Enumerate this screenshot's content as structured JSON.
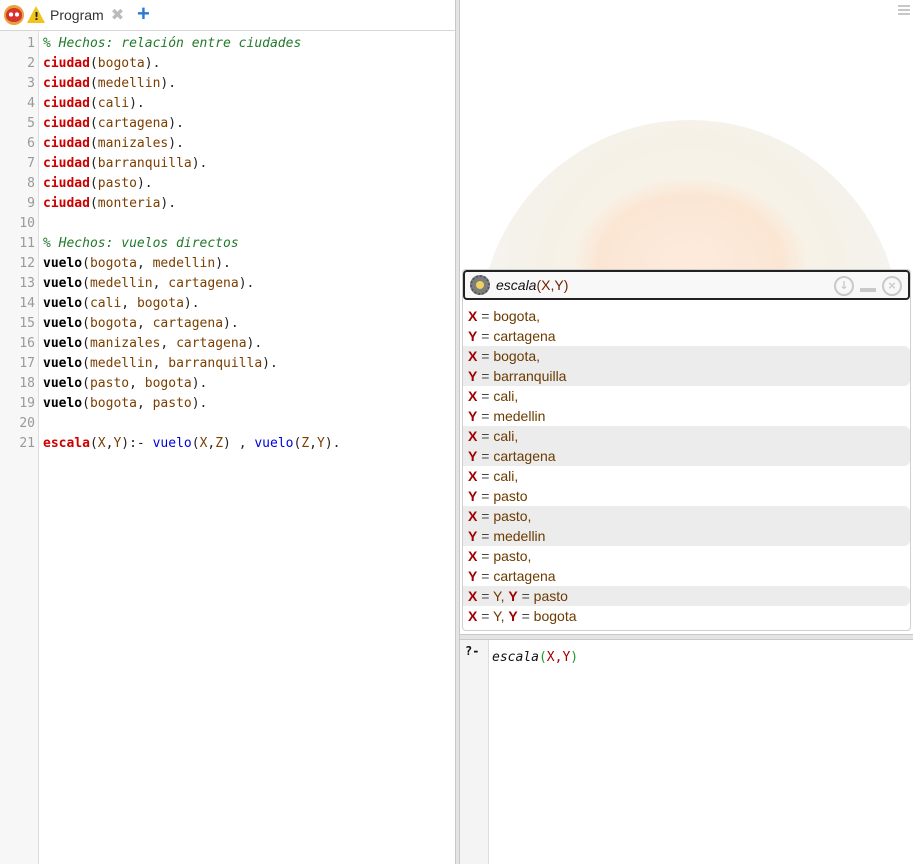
{
  "tabs": [
    {
      "label": "Program",
      "icon": "warning-icon"
    }
  ],
  "code_lines": [
    [
      {
        "c": "cmt",
        "t": "% Hechos: relación entre ciudades"
      }
    ],
    [
      {
        "c": "fact",
        "t": "ciudad"
      },
      {
        "c": "op",
        "t": "("
      },
      {
        "c": "arg",
        "t": "bogota"
      },
      {
        "c": "op",
        "t": ")."
      }
    ],
    [
      {
        "c": "fact",
        "t": "ciudad"
      },
      {
        "c": "op",
        "t": "("
      },
      {
        "c": "arg",
        "t": "medellin"
      },
      {
        "c": "op",
        "t": ")."
      }
    ],
    [
      {
        "c": "fact",
        "t": "ciudad"
      },
      {
        "c": "op",
        "t": "("
      },
      {
        "c": "arg",
        "t": "cali"
      },
      {
        "c": "op",
        "t": ")."
      }
    ],
    [
      {
        "c": "fact",
        "t": "ciudad"
      },
      {
        "c": "op",
        "t": "("
      },
      {
        "c": "arg",
        "t": "cartagena"
      },
      {
        "c": "op",
        "t": ")."
      }
    ],
    [
      {
        "c": "fact",
        "t": "ciudad"
      },
      {
        "c": "op",
        "t": "("
      },
      {
        "c": "arg",
        "t": "manizales"
      },
      {
        "c": "op",
        "t": ")."
      }
    ],
    [
      {
        "c": "fact",
        "t": "ciudad"
      },
      {
        "c": "op",
        "t": "("
      },
      {
        "c": "arg",
        "t": "barranquilla"
      },
      {
        "c": "op",
        "t": ")."
      }
    ],
    [
      {
        "c": "fact",
        "t": "ciudad"
      },
      {
        "c": "op",
        "t": "("
      },
      {
        "c": "arg",
        "t": "pasto"
      },
      {
        "c": "op",
        "t": ")."
      }
    ],
    [
      {
        "c": "fact",
        "t": "ciudad"
      },
      {
        "c": "op",
        "t": "("
      },
      {
        "c": "arg",
        "t": "monteria"
      },
      {
        "c": "op",
        "t": ")."
      }
    ],
    [],
    [
      {
        "c": "cmt",
        "t": "% Hechos: vuelos directos"
      }
    ],
    [
      {
        "c": "pred",
        "t": "vuelo"
      },
      {
        "c": "op",
        "t": "("
      },
      {
        "c": "arg",
        "t": "bogota"
      },
      {
        "c": "op",
        "t": ", "
      },
      {
        "c": "arg",
        "t": "medellin"
      },
      {
        "c": "op",
        "t": ")."
      }
    ],
    [
      {
        "c": "pred",
        "t": "vuelo"
      },
      {
        "c": "op",
        "t": "("
      },
      {
        "c": "arg",
        "t": "medellin"
      },
      {
        "c": "op",
        "t": ", "
      },
      {
        "c": "arg",
        "t": "cartagena"
      },
      {
        "c": "op",
        "t": ")."
      }
    ],
    [
      {
        "c": "pred",
        "t": "vuelo"
      },
      {
        "c": "op",
        "t": "("
      },
      {
        "c": "arg",
        "t": "cali"
      },
      {
        "c": "op",
        "t": ", "
      },
      {
        "c": "arg",
        "t": "bogota"
      },
      {
        "c": "op",
        "t": ")."
      }
    ],
    [
      {
        "c": "pred",
        "t": "vuelo"
      },
      {
        "c": "op",
        "t": "("
      },
      {
        "c": "arg",
        "t": "bogota"
      },
      {
        "c": "op",
        "t": ", "
      },
      {
        "c": "arg",
        "t": "cartagena"
      },
      {
        "c": "op",
        "t": ")."
      }
    ],
    [
      {
        "c": "pred",
        "t": "vuelo"
      },
      {
        "c": "op",
        "t": "("
      },
      {
        "c": "arg",
        "t": "manizales"
      },
      {
        "c": "op",
        "t": ", "
      },
      {
        "c": "arg",
        "t": "cartagena"
      },
      {
        "c": "op",
        "t": ")."
      }
    ],
    [
      {
        "c": "pred",
        "t": "vuelo"
      },
      {
        "c": "op",
        "t": "("
      },
      {
        "c": "arg",
        "t": "medellin"
      },
      {
        "c": "op",
        "t": ", "
      },
      {
        "c": "arg",
        "t": "barranquilla"
      },
      {
        "c": "op",
        "t": ")."
      }
    ],
    [
      {
        "c": "pred",
        "t": "vuelo"
      },
      {
        "c": "op",
        "t": "("
      },
      {
        "c": "arg",
        "t": "pasto"
      },
      {
        "c": "op",
        "t": ", "
      },
      {
        "c": "arg",
        "t": "bogota"
      },
      {
        "c": "op",
        "t": ")."
      }
    ],
    [
      {
        "c": "pred",
        "t": "vuelo"
      },
      {
        "c": "op",
        "t": "("
      },
      {
        "c": "arg",
        "t": "bogota"
      },
      {
        "c": "op",
        "t": ", "
      },
      {
        "c": "arg",
        "t": "pasto"
      },
      {
        "c": "op",
        "t": ")."
      }
    ],
    [],
    [
      {
        "c": "fact",
        "t": "escala"
      },
      {
        "c": "op",
        "t": "("
      },
      {
        "c": "arg",
        "t": "X"
      },
      {
        "c": "op",
        "t": ","
      },
      {
        "c": "arg",
        "t": "Y"
      },
      {
        "c": "op",
        "t": "):- "
      },
      {
        "c": "goal",
        "t": "vuelo"
      },
      {
        "c": "op",
        "t": "("
      },
      {
        "c": "arg",
        "t": "X"
      },
      {
        "c": "op",
        "t": ","
      },
      {
        "c": "arg",
        "t": "Z"
      },
      {
        "c": "op",
        "t": ") , "
      },
      {
        "c": "goal",
        "t": "vuelo"
      },
      {
        "c": "op",
        "t": "("
      },
      {
        "c": "arg",
        "t": "Z"
      },
      {
        "c": "op",
        "t": ","
      },
      {
        "c": "arg",
        "t": "Y"
      },
      {
        "c": "op",
        "t": ")."
      }
    ]
  ],
  "query_panel": {
    "title_name": "escala",
    "title_args": "(X,Y)",
    "answers": [
      {
        "alt": false,
        "lines": [
          [
            {
              "c": "var",
              "t": "X"
            },
            {
              "c": "eq",
              "t": " = "
            },
            {
              "c": "val",
              "t": "bogota,"
            }
          ],
          [
            {
              "c": "var",
              "t": "Y"
            },
            {
              "c": "eq",
              "t": " = "
            },
            {
              "c": "val",
              "t": "cartagena"
            }
          ]
        ]
      },
      {
        "alt": true,
        "lines": [
          [
            {
              "c": "var",
              "t": "X"
            },
            {
              "c": "eq",
              "t": " = "
            },
            {
              "c": "val",
              "t": "bogota,"
            }
          ],
          [
            {
              "c": "var",
              "t": "Y"
            },
            {
              "c": "eq",
              "t": " = "
            },
            {
              "c": "val",
              "t": "barranquilla"
            }
          ]
        ]
      },
      {
        "alt": false,
        "lines": [
          [
            {
              "c": "var",
              "t": "X"
            },
            {
              "c": "eq",
              "t": " = "
            },
            {
              "c": "val",
              "t": "cali,"
            }
          ],
          [
            {
              "c": "var",
              "t": "Y"
            },
            {
              "c": "eq",
              "t": " = "
            },
            {
              "c": "val",
              "t": "medellin"
            }
          ]
        ]
      },
      {
        "alt": true,
        "lines": [
          [
            {
              "c": "var",
              "t": "X"
            },
            {
              "c": "eq",
              "t": " = "
            },
            {
              "c": "val",
              "t": "cali,"
            }
          ],
          [
            {
              "c": "var",
              "t": "Y"
            },
            {
              "c": "eq",
              "t": " = "
            },
            {
              "c": "val",
              "t": "cartagena"
            }
          ]
        ]
      },
      {
        "alt": false,
        "lines": [
          [
            {
              "c": "var",
              "t": "X"
            },
            {
              "c": "eq",
              "t": " = "
            },
            {
              "c": "val",
              "t": "cali,"
            }
          ],
          [
            {
              "c": "var",
              "t": "Y"
            },
            {
              "c": "eq",
              "t": " = "
            },
            {
              "c": "val",
              "t": "pasto"
            }
          ]
        ]
      },
      {
        "alt": true,
        "lines": [
          [
            {
              "c": "var",
              "t": "X"
            },
            {
              "c": "eq",
              "t": " = "
            },
            {
              "c": "val",
              "t": "pasto,"
            }
          ],
          [
            {
              "c": "var",
              "t": "Y"
            },
            {
              "c": "eq",
              "t": " = "
            },
            {
              "c": "val",
              "t": "medellin"
            }
          ]
        ]
      },
      {
        "alt": false,
        "lines": [
          [
            {
              "c": "var",
              "t": "X"
            },
            {
              "c": "eq",
              "t": " = "
            },
            {
              "c": "val",
              "t": "pasto,"
            }
          ],
          [
            {
              "c": "var",
              "t": "Y"
            },
            {
              "c": "eq",
              "t": " = "
            },
            {
              "c": "val",
              "t": "cartagena"
            }
          ]
        ]
      },
      {
        "alt": true,
        "lines": [
          [
            {
              "c": "var",
              "t": "X"
            },
            {
              "c": "eq",
              "t": " = "
            },
            {
              "c": "val",
              "t": "Y, "
            },
            {
              "c": "var",
              "t": "Y"
            },
            {
              "c": "eq",
              "t": " = "
            },
            {
              "c": "val",
              "t": "pasto"
            }
          ]
        ]
      },
      {
        "alt": false,
        "lines": [
          [
            {
              "c": "var",
              "t": "X"
            },
            {
              "c": "eq",
              "t": " = "
            },
            {
              "c": "val",
              "t": "Y, "
            },
            {
              "c": "var",
              "t": "Y"
            },
            {
              "c": "eq",
              "t": " = "
            },
            {
              "c": "val",
              "t": "bogota"
            }
          ]
        ]
      }
    ]
  },
  "query_input": {
    "prompt": "?-",
    "name": "escala",
    "open": "(",
    "args": "X,Y",
    "close": ")"
  }
}
